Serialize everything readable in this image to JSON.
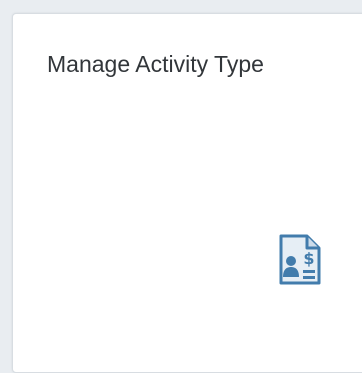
{
  "tile": {
    "title": "Manage Activity Type",
    "icon": "activity-cost-document-icon",
    "icon_color": "#427cac"
  }
}
